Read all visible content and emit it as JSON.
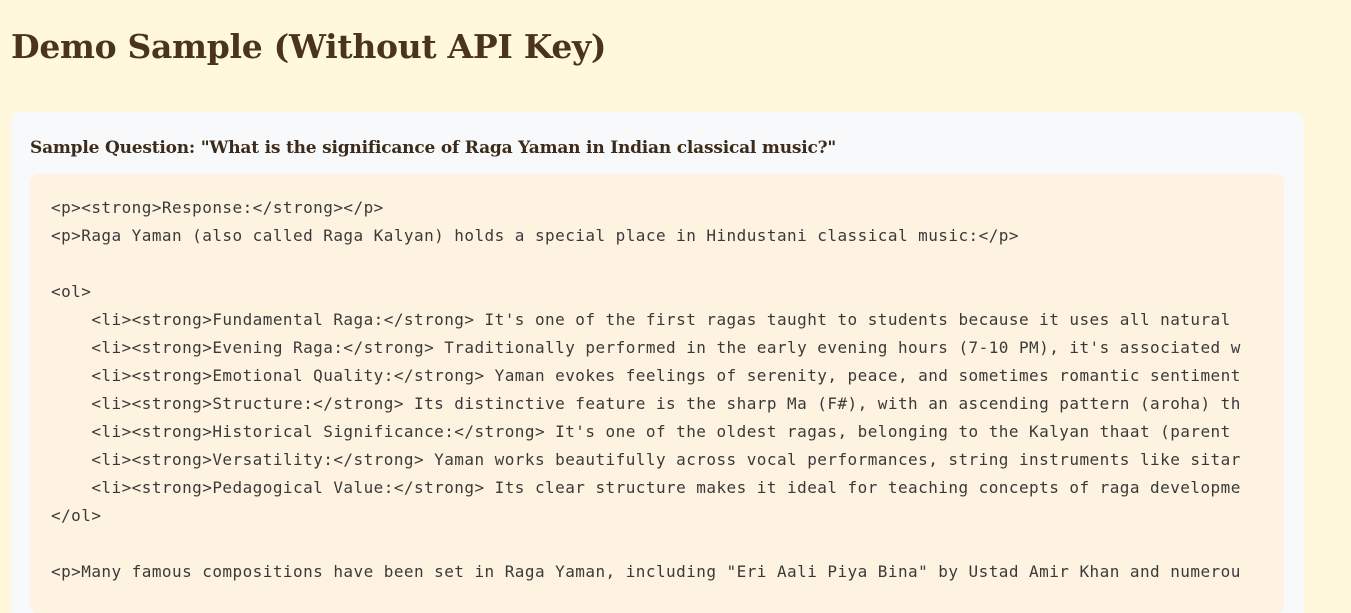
{
  "page": {
    "title": "Demo Sample (Without API Key)"
  },
  "sample": {
    "question": "Sample Question: \"What is the significance of Raga Yaman in Indian classical music?\"",
    "response_lines": [
      "<p><strong>Response:</strong></p>",
      "<p>Raga Yaman (also called Raga Kalyan) holds a special place in Hindustani classical music:</p>",
      "",
      "<ol>",
      "    <li><strong>Fundamental Raga:</strong> It's one of the first ragas taught to students because it uses all natural",
      "    <li><strong>Evening Raga:</strong> Traditionally performed in the early evening hours (7-10 PM), it's associated w",
      "    <li><strong>Emotional Quality:</strong> Yaman evokes feelings of serenity, peace, and sometimes romantic sentiment",
      "    <li><strong>Structure:</strong> Its distinctive feature is the sharp Ma (F#), with an ascending pattern (aroha) th",
      "    <li><strong>Historical Significance:</strong> It's one of the oldest ragas, belonging to the Kalyan thaat (parent",
      "    <li><strong>Versatility:</strong> Yaman works beautifully across vocal performances, string instruments like sitar",
      "    <li><strong>Pedagogical Value:</strong> Its clear structure makes it ideal for teaching concepts of raga developme",
      "</ol>",
      "",
      "<p>Many famous compositions have been set in Raga Yaman, including \"Eri Aali Piya Bina\" by Ustad Amir Khan and numerou"
    ]
  },
  "colors": {
    "page_background": "#fff8dc",
    "card_background": "#f8f9fa",
    "code_background": "#fdf3e0",
    "title_text": "#4a3420",
    "code_text": "#3a3a3a"
  }
}
